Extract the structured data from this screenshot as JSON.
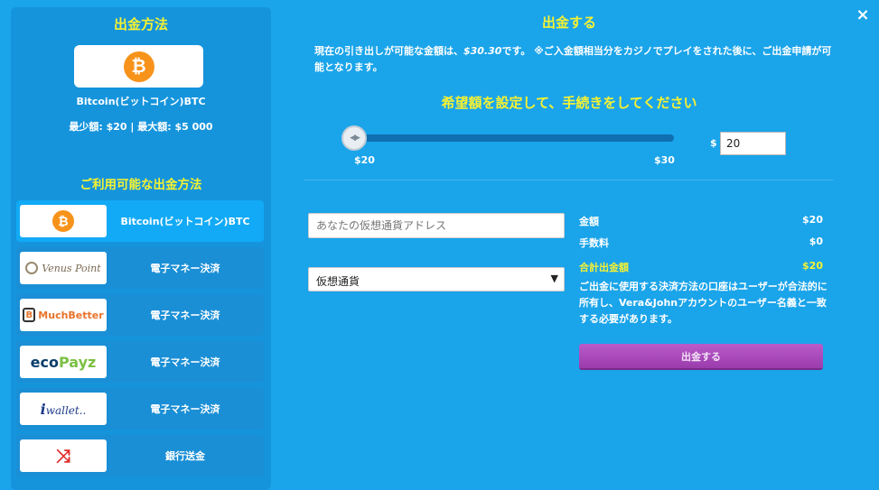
{
  "left": {
    "title": "出金方法",
    "selected": {
      "name": "Bitcoin(ビットコイン)BTC",
      "limits": "最少額: $20 | 最大額: $5 000",
      "logo_icon": "bitcoin-icon",
      "logo_glyph": "₿"
    },
    "available_title": "ご利用可能な出金方法",
    "methods": [
      {
        "label": "Bitcoin(ビットコイン)BTC",
        "logo_text": "₿",
        "logo_icon": "bitcoin-icon",
        "active": true
      },
      {
        "label": "電子マネー決済",
        "logo_text": "Venus Point",
        "logo_icon": "venus-point-logo"
      },
      {
        "label": "電子マネー決済",
        "logo_text": "MuchBetter",
        "logo_icon": "muchbetter-logo"
      },
      {
        "label": "電子マネー決済",
        "logo_text_a": "eco",
        "logo_text_b": "Payz",
        "logo_icon": "ecopayz-logo"
      },
      {
        "label": "電子マネー決済",
        "logo_text_a": "i",
        "logo_text_b": "wallet..",
        "logo_icon": "iwallet-logo"
      },
      {
        "label": "銀行送金",
        "logo_text": "⤨",
        "logo_icon": "shuffle-icon"
      }
    ]
  },
  "right": {
    "title": "出金する",
    "close_glyph": "×",
    "desc_prefix": "現在の引き出しが可能な金額は、",
    "desc_amount": "$30.30",
    "desc_suffix": "です。 ※ご入金額相当分をカジノでプレイをされた後に、ご出金申請が可能となります。",
    "prompt": "希望額を設定して、手続きをしてください",
    "slider": {
      "min_label": "$20",
      "max_label": "$30",
      "value_fraction": 0.0,
      "handle_glyph": "◀▶"
    },
    "currency_symbol": "$",
    "amount_value": "20",
    "address_placeholder": "あなたの仮想通貨アドレス",
    "currency_select": {
      "value": "仮想通貨",
      "arrow": "▼"
    },
    "summary": {
      "amount_label": "金額",
      "amount_value": "$20",
      "fee_label": "手数料",
      "fee_value": "$0",
      "total_label": "合計出金額",
      "total_value": "$20"
    },
    "note": "ご出金に使用する決済方法の口座はユーザーが合法的に所有し、Vera&Johnアカウントのユーザー名義と一致する必要があります。",
    "submit_label": "出金する"
  },
  "colors": {
    "background": "#1aa4ea",
    "panel": "#1594dc",
    "heading_yellow": "#f6f231",
    "submit_purple": "#a446b7",
    "bitcoin_orange": "#f7931a"
  }
}
